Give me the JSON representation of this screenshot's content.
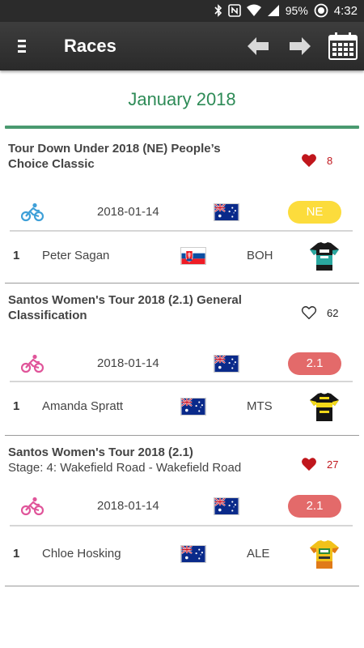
{
  "status_bar": {
    "battery": "95%",
    "time": "4:32",
    "icons": [
      "bluetooth-icon",
      "nfc-icon",
      "wifi-icon",
      "signal-icon",
      "battery-icon"
    ]
  },
  "app_bar": {
    "title": "Races",
    "icons": [
      "menu-icon",
      "arrow-left-icon",
      "arrow-right-icon",
      "calendar-icon"
    ]
  },
  "month": "January 2018",
  "colors": {
    "month_text": "#2e8b57",
    "heart": "#c0161c",
    "badge_ne": "#fcdc3c",
    "badge_cat": "#e36a6a",
    "bike_men": "#3fa0d8",
    "bike_women": "#e0559a"
  },
  "races": [
    {
      "title": "Tour Down Under 2018 (NE) People’s Choice Classic",
      "subtitle": "",
      "liked": true,
      "likes": "8",
      "bike": "bicycle-icon",
      "date": "2018-01-14",
      "country_flag": "australia-flag",
      "category": "NE",
      "result": {
        "rank": "1",
        "rider": "Peter Sagan",
        "rider_flag": "slovakia-flag",
        "team": "BOH",
        "jersey": "bora-jersey"
      }
    },
    {
      "title": "Santos Women's Tour 2018 (2.1) General Classification",
      "subtitle": "",
      "liked": false,
      "likes": "62",
      "bike": "bicycle-icon",
      "date": "2018-01-14",
      "country_flag": "australia-flag",
      "category": "2.1",
      "result": {
        "rank": "1",
        "rider": "Amanda Spratt",
        "rider_flag": "australia-flag",
        "team": "MTS",
        "jersey": "mitchelton-jersey"
      }
    },
    {
      "title": "Santos Women's Tour 2018 (2.1)",
      "subtitle": "Stage: 4: Wakefield Road - Wakefield Road",
      "liked": true,
      "likes": "27",
      "bike": "bicycle-icon",
      "date": "2018-01-14",
      "country_flag": "australia-flag",
      "category": "2.1",
      "result": {
        "rank": "1",
        "rider": "Chloe Hosking",
        "rider_flag": "australia-flag",
        "team": "ALE",
        "jersey": "ale-jersey"
      }
    }
  ]
}
